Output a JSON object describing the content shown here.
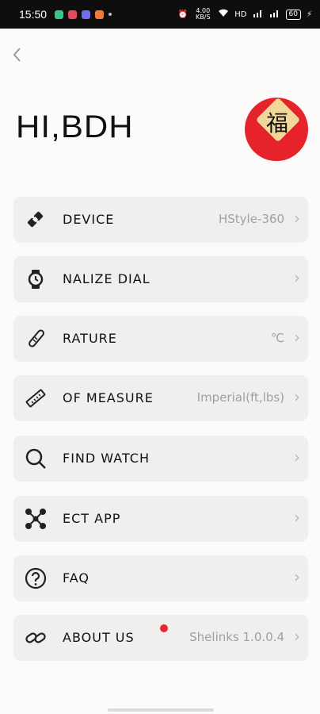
{
  "status_bar": {
    "time": "15:50",
    "network_speed": "4.00 KB/S",
    "net_label": "HD",
    "battery": "60"
  },
  "header": {
    "greeting": "HI,BDH",
    "avatar_glyph": "福"
  },
  "menu": {
    "items": [
      {
        "label": "DEVICE",
        "value": "HStyle-360",
        "icon": "device-link-icon"
      },
      {
        "label": "NALIZE DIAL",
        "value": "",
        "icon": "watch-icon"
      },
      {
        "label": "RATURE",
        "value": "℃",
        "icon": "thermometer-icon"
      },
      {
        "label": "OF MEASURE",
        "value": "Imperial(ft,lbs)",
        "icon": "ruler-icon"
      },
      {
        "label": "FIND WATCH",
        "value": "",
        "icon": "search-icon"
      },
      {
        "label": "ECT APP",
        "value": "",
        "icon": "connect-app-icon"
      },
      {
        "label": "FAQ",
        "value": "",
        "icon": "question-icon"
      },
      {
        "label": "ABOUT US",
        "value": "Shelinks 1.0.0.4",
        "icon": "link-icon"
      }
    ]
  },
  "colors": {
    "background": "#fcfbfa",
    "row_bg": "#f1efee",
    "accent_red": "#e6232a"
  }
}
